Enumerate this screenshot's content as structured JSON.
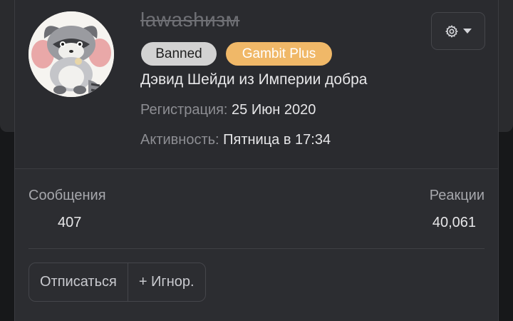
{
  "profile": {
    "username": "lawashизм",
    "badges": [
      "Banned",
      "Gambit Plus"
    ],
    "user_title": "Дэвид Шейди из Империи добра",
    "registration": {
      "label": "Регистрация:",
      "value": "25 Июн 2020"
    },
    "activity": {
      "label": "Активность:",
      "value": "Пятница в 17:34"
    }
  },
  "stats": {
    "messages": {
      "label": "Сообщения",
      "value": "407"
    },
    "reactions": {
      "label": "Реакции",
      "value": "40,061"
    }
  },
  "actions": {
    "unsubscribe": "Отписаться",
    "ignore": "+ Игнор."
  },
  "colors": {
    "banned_badge": "#d2d2d2",
    "gambit_badge": "#f0b868",
    "card_background": "#2a2b2f"
  },
  "icons": {
    "settings_button": [
      "gear-icon",
      "caret-down-icon"
    ]
  }
}
